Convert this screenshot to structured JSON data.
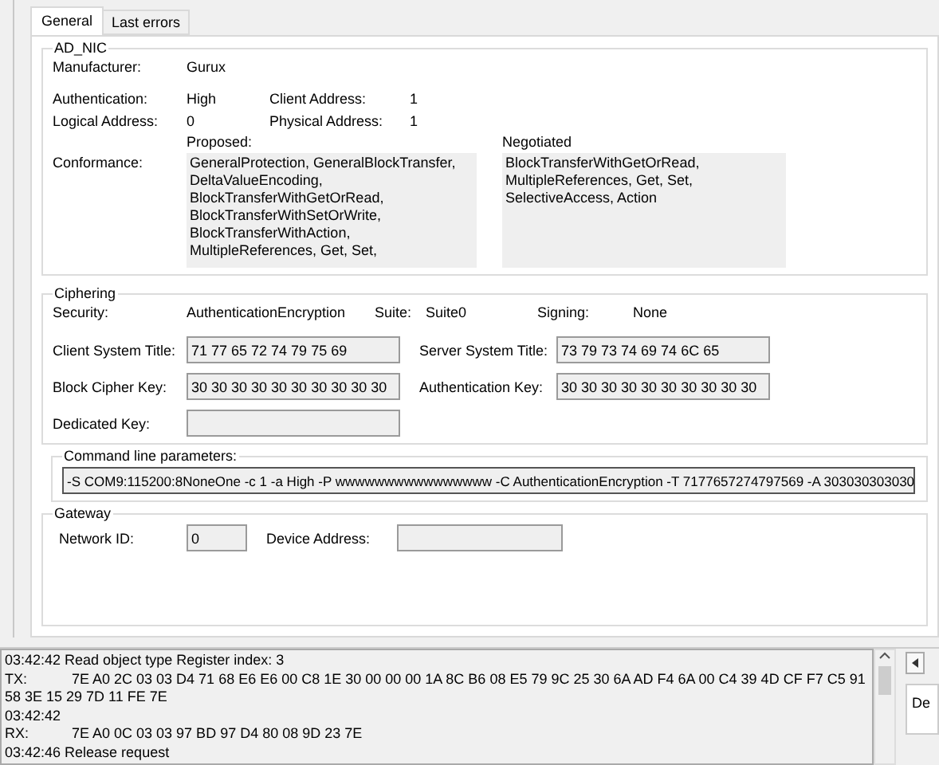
{
  "tabs": [
    {
      "label": "General",
      "selected": true
    },
    {
      "label": "Last errors",
      "selected": false
    }
  ],
  "device": {
    "title": "AD_NIC",
    "manufacturer": {
      "label": "Manufacturer:",
      "value": "Gurux"
    },
    "authentication": {
      "label": "Authentication:",
      "value": "High"
    },
    "client_address": {
      "label": "Client Address:",
      "value": "1"
    },
    "logical_address": {
      "label": "Logical Address:",
      "value": "0"
    },
    "physical_address": {
      "label": "Physical Address:",
      "value": "1"
    },
    "conformance": {
      "label": "Conformance:",
      "proposed_label": "Proposed:",
      "proposed": [
        "GeneralProtection, GeneralBlockTransfer,",
        "DeltaValueEncoding,",
        "BlockTransferWithGetOrRead,",
        "BlockTransferWithSetOrWrite,",
        "BlockTransferWithAction,",
        "MultipleReferences, Get, Set,"
      ],
      "negotiated_label": "Negotiated",
      "negotiated": [
        "BlockTransferWithGetOrRead,",
        "MultipleReferences, Get, Set,",
        "SelectiveAccess, Action"
      ]
    }
  },
  "ciphering": {
    "title": "Ciphering",
    "security": {
      "label": "Security:",
      "value": "AuthenticationEncryption"
    },
    "suite": {
      "label": "Suite:",
      "value": "Suite0"
    },
    "signing": {
      "label": "Signing:",
      "value": "None"
    },
    "client_system_title": {
      "label": "Client System Title:",
      "value": "71 77 65 72 74 79 75 69"
    },
    "server_system_title": {
      "label": "Server System Title:",
      "value": "73 79 73 74 69 74 6C 65"
    },
    "block_cipher_key": {
      "label": "Block Cipher Key:",
      "value": "30 30 30 30 30 30 30 30 30 30"
    },
    "authentication_key": {
      "label": "Authentication Key:",
      "value": "30 30 30 30 30 30 30 30 30 30"
    },
    "dedicated_key": {
      "label": "Dedicated Key:"
    }
  },
  "command_line": {
    "title": "Command line parameters:",
    "value": "-S COM9:115200:8NoneOne -c 1 -a High -P wwwwwwwwwwwwwwww -C AuthenticationEncryption -T 7177657274797569 -A 303030303030"
  },
  "gateway": {
    "title": "Gateway",
    "network_id": {
      "label": "Network ID:",
      "value": "0"
    },
    "device_address": {
      "label": "Device Address:"
    }
  },
  "log": [
    {
      "text": "03:42:42 Read object type Register index: 3"
    },
    {
      "tag": "TX:",
      "text": "7E A0 2C 03 03 D4 71 68 E6 E6 00 C8 1E 30 00 00 00 1A 8C B6 08 E5 79 9C 25 30 6A AD F4 6A 00 C4 39 4D CF F7 C5 91"
    },
    {
      "text": "58 3E 15 29 7D 11 FE 7E"
    },
    {
      "text": "03:42:42"
    },
    {
      "tag": "RX:",
      "text": "7E A0 0C 03 03 97 BD 97 D4 80 08 9D 23 7E"
    },
    {
      "text": "03:42:46 Release request"
    }
  ],
  "side_panel": {
    "text": "De"
  }
}
